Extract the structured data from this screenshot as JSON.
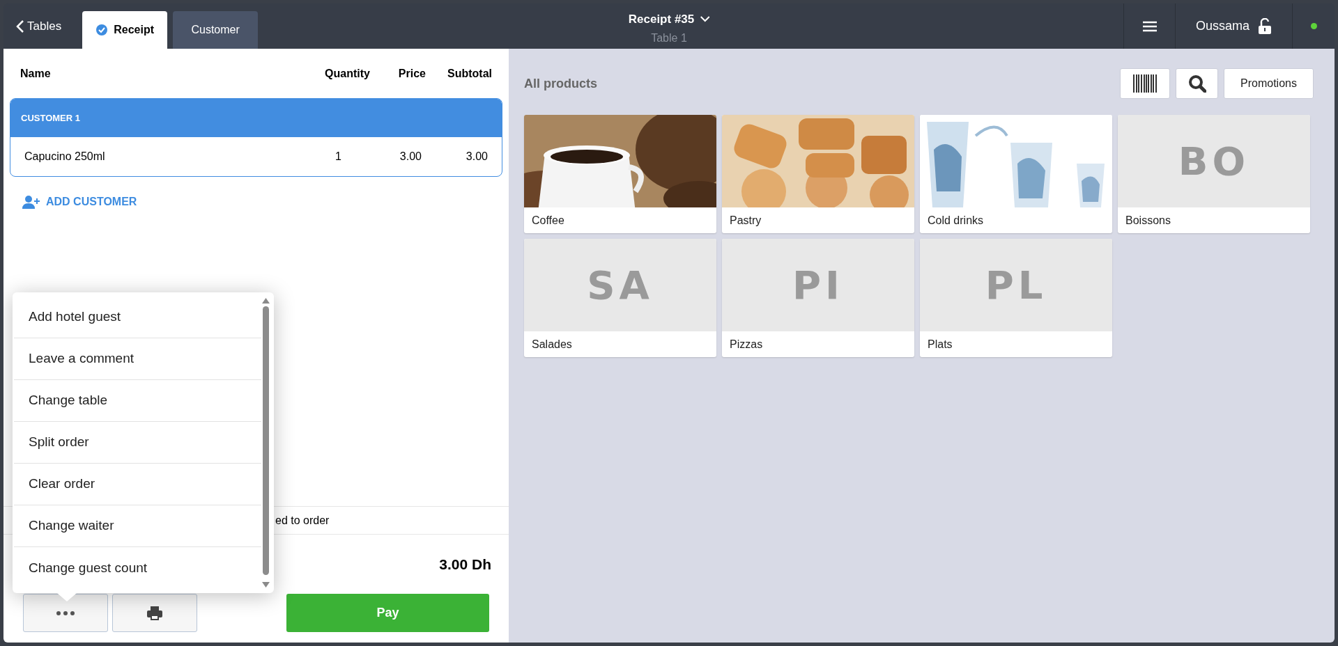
{
  "top_bar": {
    "back": "Tables",
    "tabs": [
      {
        "label": "Receipt",
        "selected": true
      },
      {
        "label": "Customer",
        "selected": false
      }
    ],
    "title": "Receipt #35",
    "subtitle": "Table 1",
    "user": "Oussama",
    "locked": false,
    "online": true
  },
  "order": {
    "columns": [
      "Name",
      "Quantity",
      "Price",
      "Subtotal"
    ],
    "groups": [
      {
        "name": "CUSTOMER 1",
        "selected": true,
        "items": [
          {
            "name": "Capucino 250ml",
            "quantity": "1",
            "price": "3.00",
            "subtotal": "3.00"
          }
        ]
      }
    ],
    "add_customer": "ADD CUSTOMER",
    "comment_visible": "ed to order",
    "total": "3.00 Dh",
    "pay": "Pay"
  },
  "menu": {
    "items": [
      "Add hotel guest",
      "Leave a comment",
      "Change table",
      "Split order",
      "Clear order",
      "Change waiter",
      "Change guest count"
    ]
  },
  "products": {
    "title": "All products",
    "promotions": "Promotions",
    "categories": [
      {
        "name": "Coffee",
        "kind": "picture"
      },
      {
        "name": "Pastry",
        "kind": "picture"
      },
      {
        "name": "Cold drinks",
        "kind": "picture"
      },
      {
        "name": "Boissons",
        "kind": "initials",
        "initials": "BO"
      },
      {
        "name": "Salades",
        "kind": "initials",
        "initials": "SA"
      },
      {
        "name": "Pizzas",
        "kind": "initials",
        "initials": "PI"
      },
      {
        "name": "Plats",
        "kind": "initials",
        "initials": "PL"
      }
    ]
  }
}
